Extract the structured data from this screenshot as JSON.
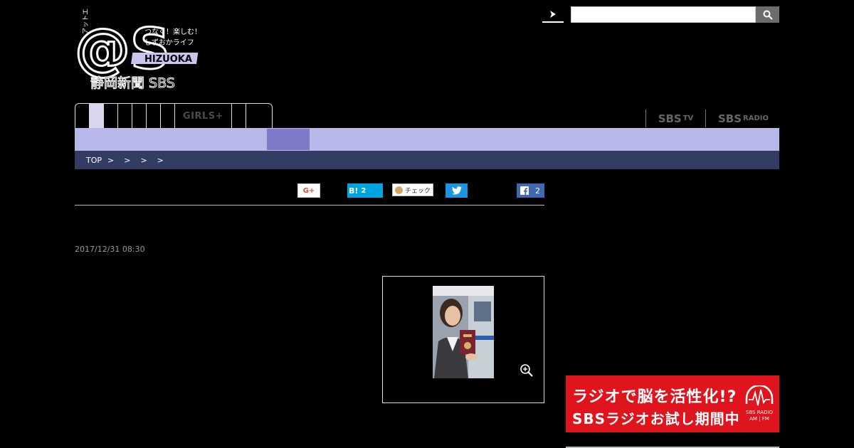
{
  "logo": {
    "title_text": "@S",
    "katakana": "アットエス",
    "tagline_1": "つなぐ！楽しむ！",
    "tagline_2": "しずおかライフ",
    "shizuoka_text": "HIZUOKA",
    "publisher": "静岡新聞 SBS"
  },
  "search": {
    "placeholder": "",
    "button_icon": "search-icon"
  },
  "nav": {
    "girls_label": "GIRLS+"
  },
  "brand_links": {
    "sbs_tv": "SBS",
    "sbs_tv_suffix": "TV",
    "sbs_radio": "SBS",
    "sbs_radio_suffix": "RADIO"
  },
  "breadcrumb": {
    "top": "TOP",
    "sep1": ">",
    "sep2": ">",
    "sep3": ">",
    "sep4": ">"
  },
  "share": {
    "gplus_label": "G+",
    "hatena_label": "B!",
    "hatena_count": "2",
    "mixi_label": "チェック",
    "facebook_count": "2"
  },
  "article": {
    "date": "2017/12/31 08:30"
  },
  "ad": {
    "line1": "ラジオで脳を活性化!?",
    "line2": "SBSラジオお試し期間中",
    "logo_line1": "SBS RADIO",
    "logo_line2": "AM | FM"
  },
  "colors": {
    "subnav": "#b9b8ea",
    "subnav_active": "#7f7ac7",
    "breadcrumb_bg": "#333c63",
    "ad_bg": "#e0141c",
    "hatena": "#00a4de",
    "twitter": "#1b95e0",
    "facebook": "#4267b2"
  }
}
